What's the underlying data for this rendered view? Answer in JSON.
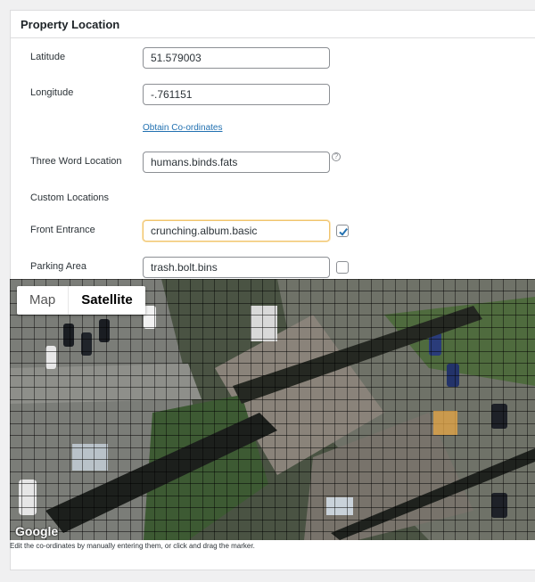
{
  "panel": {
    "title": "Property Location"
  },
  "fields": {
    "latitude": {
      "label": "Latitude",
      "value": "51.579003"
    },
    "longitude": {
      "label": "Longitude",
      "value": "-.761151"
    },
    "obtain_link": "Obtain Co-ordinates",
    "three_word": {
      "label": "Three Word Location",
      "value": "humans.binds.fats",
      "help": "?"
    },
    "custom_heading": "Custom Locations",
    "front_entrance": {
      "label": "Front Entrance",
      "value": "crunching.album.basic",
      "checked": true
    },
    "parking_area": {
      "label": "Parking Area",
      "value": "trash.bolt.bins",
      "checked": false
    }
  },
  "map": {
    "type_buttons": [
      "Map",
      "Satellite"
    ],
    "active_type": "Satellite",
    "attribution": "Google",
    "caption": "Edit the co-ordinates by manually entering them, or click and drag the marker."
  },
  "colors": {
    "accent": "#2271b1",
    "focus_border": "#f0c36d",
    "checkbox_check": "#2271b1",
    "highlight_cell": "#e8a845"
  }
}
